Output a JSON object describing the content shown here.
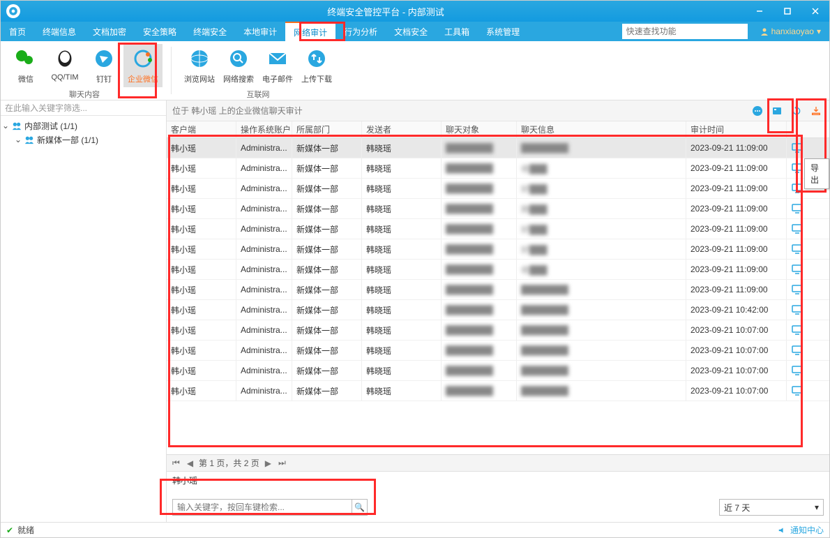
{
  "title": "终端安全管控平台 - 内部测试",
  "user": "hanxiaoyao",
  "searchPlaceholder": "快速查找功能",
  "menus": [
    "首页",
    "终端信息",
    "文档加密",
    "安全策略",
    "终端安全",
    "本地审计",
    "网络审计",
    "行为分析",
    "文档安全",
    "工具箱",
    "系统管理"
  ],
  "activeMenu": 6,
  "ribbon": {
    "groups": [
      {
        "label": "聊天内容",
        "items": [
          {
            "label": "微信",
            "icon": "wechat"
          },
          {
            "label": "QQ/TIM",
            "icon": "qq"
          },
          {
            "label": "钉钉",
            "icon": "dingtalk"
          },
          {
            "label": "企业微信",
            "icon": "wecom",
            "selected": true
          }
        ]
      },
      {
        "label": "互联网",
        "items": [
          {
            "label": "浏览网站",
            "icon": "globe"
          },
          {
            "label": "网络搜索",
            "icon": "search"
          },
          {
            "label": "电子邮件",
            "icon": "mail"
          },
          {
            "label": "上传下载",
            "icon": "updown"
          }
        ]
      }
    ]
  },
  "sidebar": {
    "filterPlaceholder": "在此输入关键字筛选...",
    "nodes": [
      {
        "label": "内部测试 (1/1)",
        "indent": 0,
        "expanded": true
      },
      {
        "label": "新媒体一部 (1/1)",
        "indent": 1,
        "expanded": true
      }
    ]
  },
  "crumb": "位于 韩小瑶 上的企业微信聊天审计",
  "columns": [
    "客户端",
    "操作系统账户",
    "所属部门",
    "发送者",
    "聊天对象",
    "聊天信息",
    "审计时间",
    ""
  ],
  "rows": [
    {
      "c": [
        "韩小瑶",
        "Administra...",
        "新媒体一部",
        "韩晓瑶",
        "█",
        "█",
        "2023-09-21 11:09:00"
      ],
      "sel": true
    },
    {
      "c": [
        "韩小瑶",
        "Administra...",
        "新媒体一部",
        "韩晓瑶",
        "█",
        "收",
        "2023-09-21 11:09:00"
      ]
    },
    {
      "c": [
        "韩小瑶",
        "Administra...",
        "新媒体一部",
        "韩晓瑶",
        "█",
        "好",
        "2023-09-21 11:09:00"
      ]
    },
    {
      "c": [
        "韩小瑶",
        "Administra...",
        "新媒体一部",
        "韩晓瑶",
        "█",
        "刚",
        "2023-09-21 11:09:00"
      ]
    },
    {
      "c": [
        "韩小瑶",
        "Administra...",
        "新媒体一部",
        "韩晓瑶",
        "█",
        "好",
        "2023-09-21 11:09:00"
      ]
    },
    {
      "c": [
        "韩小瑶",
        "Administra...",
        "新媒体一部",
        "韩晓瑶",
        "█",
        "好",
        "2023-09-21 11:09:00"
      ]
    },
    {
      "c": [
        "韩小瑶",
        "Administra...",
        "新媒体一部",
        "韩晓瑶",
        "█",
        "收",
        "2023-09-21 11:09:00"
      ]
    },
    {
      "c": [
        "韩小瑶",
        "Administra...",
        "新媒体一部",
        "韩晓瑶",
        "█",
        "█",
        "2023-09-21 11:09:00"
      ]
    },
    {
      "c": [
        "韩小瑶",
        "Administra...",
        "新媒体一部",
        "韩晓瑶",
        "█",
        "█",
        "2023-09-21 10:42:00"
      ]
    },
    {
      "c": [
        "韩小瑶",
        "Administra...",
        "新媒体一部",
        "韩晓瑶",
        "█",
        "█",
        "2023-09-21 10:07:00"
      ]
    },
    {
      "c": [
        "韩小瑶",
        "Administra...",
        "新媒体一部",
        "韩晓瑶",
        "█",
        "█",
        "2023-09-21 10:07:00"
      ]
    },
    {
      "c": [
        "韩小瑶",
        "Administra...",
        "新媒体一部",
        "韩晓瑶",
        "█",
        "█",
        "2023-09-21 10:07:00"
      ]
    },
    {
      "c": [
        "韩小瑶",
        "Administra...",
        "新媒体一部",
        "韩晓瑶",
        "█",
        "█",
        "2023-09-21 10:07:00"
      ]
    }
  ],
  "pager": "第 1 页，共 2 页",
  "detailName": "韩小瑶",
  "kwPlaceholder": "输入关键字，按回车键检索...",
  "rangeLabel": "近 7 天",
  "status": "就绪",
  "notify": "通知中心",
  "exportTip": "导出"
}
